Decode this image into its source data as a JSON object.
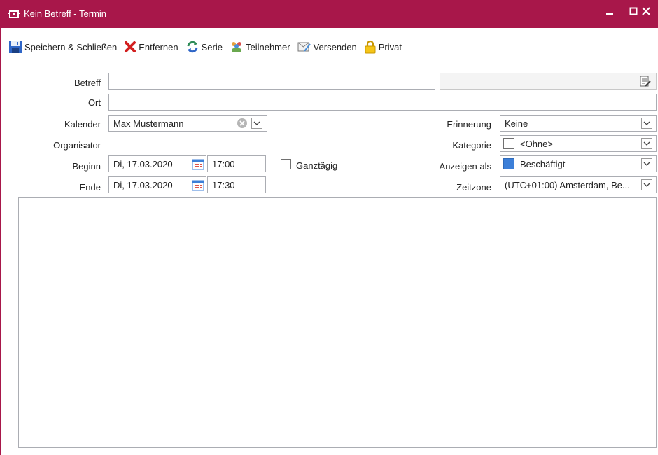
{
  "window": {
    "title": "Kein Betreff - Termin",
    "accent_color": "#a8174a",
    "controls": {
      "minimize": "—",
      "maximize": "☐",
      "close": "✕"
    }
  },
  "toolbar": {
    "save_close": "Speichern & Schließen",
    "remove": "Entfernen",
    "series": "Serie",
    "participants": "Teilnehmer",
    "send": "Versenden",
    "private": "Privat"
  },
  "form": {
    "subject": {
      "label": "Betreff",
      "value": ""
    },
    "location": {
      "label": "Ort",
      "value": ""
    },
    "calendar": {
      "label": "Kalender",
      "value": "Max Mustermann"
    },
    "organizer": {
      "label": "Organisator",
      "value": ""
    },
    "start": {
      "label": "Beginn",
      "date": "Di, 17.03.2020",
      "time": "17:00"
    },
    "end": {
      "label": "Ende",
      "date": "Di, 17.03.2020",
      "time": "17:30"
    },
    "all_day": {
      "label": "Ganztägig",
      "checked": false
    },
    "reminder": {
      "label": "Erinnerung",
      "value": "Keine"
    },
    "category": {
      "label": "Kategorie",
      "value": "<Ohne>"
    },
    "show_as": {
      "label": "Anzeigen als",
      "value": "Beschäftigt",
      "color": "#3c7fd8"
    },
    "timezone": {
      "label": "Zeitzone",
      "value": "(UTC+01:00) Amsterdam, Be..."
    }
  }
}
